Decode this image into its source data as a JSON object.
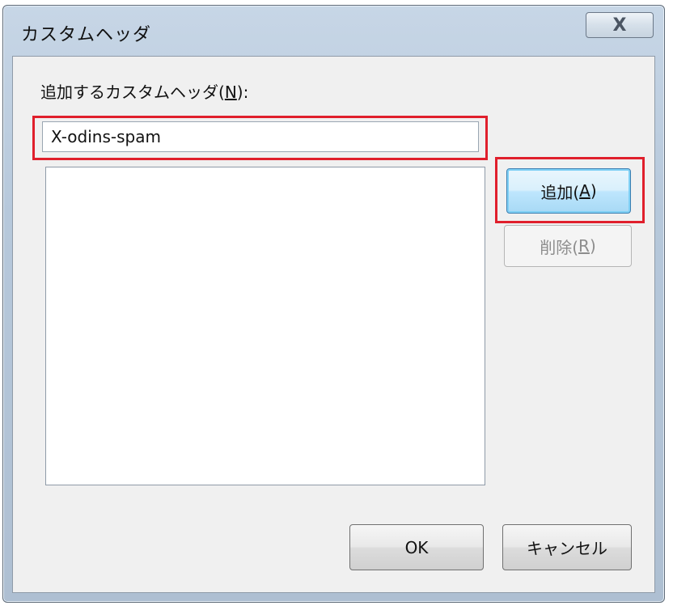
{
  "window": {
    "title": "カスタムヘッダ",
    "close_glyph": "X"
  },
  "form": {
    "field_label_prefix": "追加するカスタムヘッダ(",
    "field_label_mnemonic": "N",
    "field_label_suffix": "):",
    "input_value": "X-odins-spam",
    "list_items": []
  },
  "buttons": {
    "add_prefix": "追加(",
    "add_mnemonic": "A",
    "add_suffix": ")",
    "delete_prefix": "削除(",
    "delete_mnemonic": "R",
    "delete_suffix": ")",
    "ok": "OK",
    "cancel": "キャンセル"
  },
  "colors": {
    "highlight": "#e01f2c",
    "dialog_face": "#f0f0f0",
    "titlebar": "#b6c8db"
  }
}
